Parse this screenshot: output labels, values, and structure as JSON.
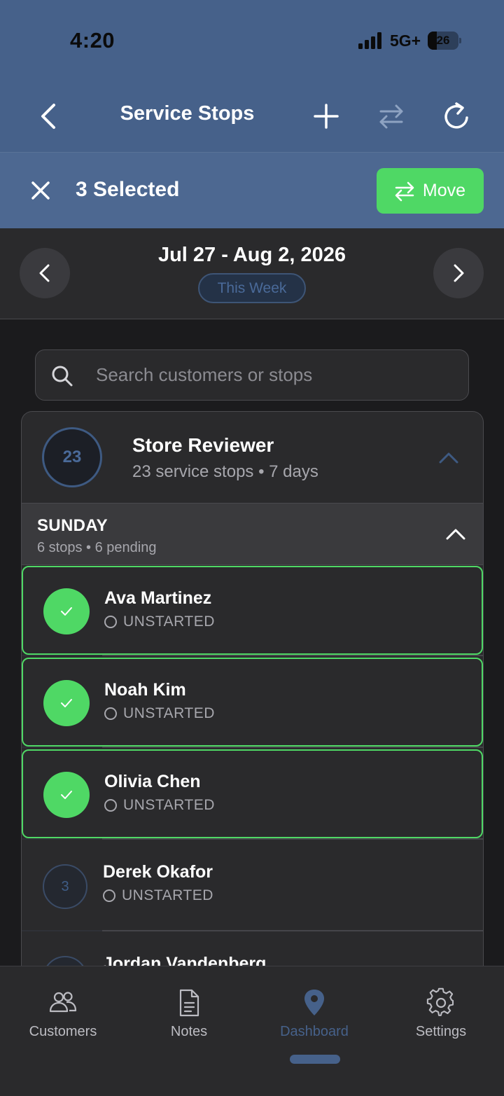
{
  "status_bar": {
    "time": "4:20",
    "network": "5G+",
    "battery": "26"
  },
  "navbar": {
    "title": "Service Stops",
    "icons": [
      "chevron-left-icon",
      "plus-icon",
      "swap-icon",
      "refresh-icon"
    ]
  },
  "selection": {
    "label": "3 Selected",
    "move_label": "Move",
    "accent": "#4fd865"
  },
  "week": {
    "range": "Jul 27 - Aug 2, 2026",
    "pill": "This Week"
  },
  "search": {
    "placeholder": "Search customers or stops"
  },
  "group": {
    "count": "23",
    "name": "Store Reviewer",
    "subtitle": "23 service stops • 7 days"
  },
  "day": {
    "name": "SUNDAY",
    "subtitle": "6 stops • 6 pending"
  },
  "stops": [
    {
      "name": "Ava Martinez",
      "status": "UNSTARTED",
      "selected": true
    },
    {
      "name": "Noah Kim",
      "status": "UNSTARTED",
      "selected": true
    },
    {
      "name": "Olivia Chen",
      "status": "UNSTARTED",
      "selected": true
    },
    {
      "name": "Derek Okafor",
      "status": "UNSTARTED",
      "selected": false,
      "number": "3"
    },
    {
      "name": "Jordan Vandenberg",
      "status": "",
      "selected": false
    }
  ],
  "tabs": [
    {
      "label": "Customers",
      "icon": "users-icon",
      "active": false
    },
    {
      "label": "Notes",
      "icon": "document-icon",
      "active": false
    },
    {
      "label": "Dashboard",
      "icon": "map-pin-icon",
      "active": true
    },
    {
      "label": "Settings",
      "icon": "gear-icon",
      "active": false
    }
  ],
  "colors": {
    "header": "#46618a",
    "selection_bar": "#4d6891",
    "accent_green": "#4fd865",
    "background": "#1b1b1d",
    "card": "#2a2a2c"
  }
}
